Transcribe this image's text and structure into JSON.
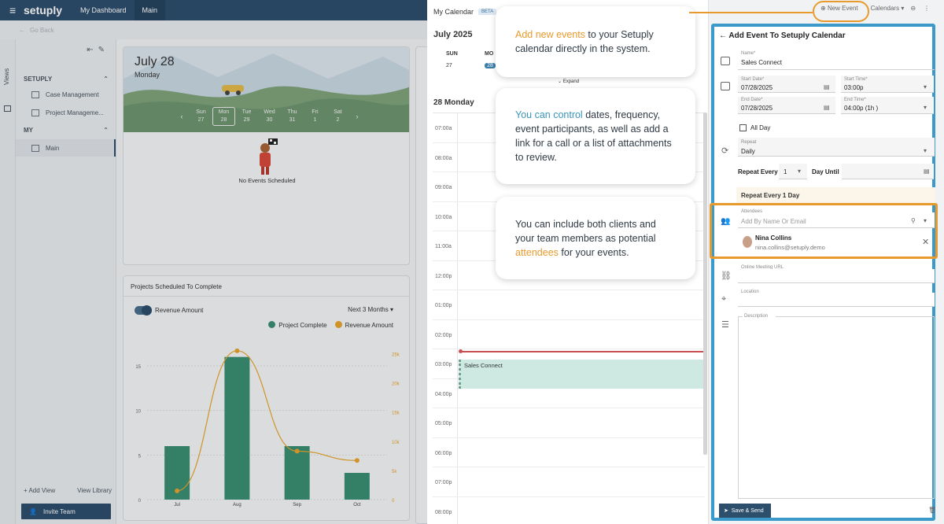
{
  "topbar": {
    "brand": "setuply",
    "tabs": [
      "My Dashboard",
      "Main"
    ]
  },
  "subbar": {
    "back_label": "Go Back"
  },
  "rail": {
    "label": "Views"
  },
  "sidebar": {
    "sections": [
      {
        "title": "SETUPLY",
        "items": [
          "Case Management",
          "Project Manageme..."
        ]
      },
      {
        "title": "MY",
        "items": [
          "Main"
        ]
      }
    ],
    "add_view": "Add View",
    "view_library": "View Library",
    "invite_team": "Invite Team"
  },
  "daycard": {
    "date": "July 28",
    "weekday": "Monday",
    "week": [
      {
        "d": "Sun",
        "n": "27"
      },
      {
        "d": "Mon",
        "n": "28"
      },
      {
        "d": "Tue",
        "n": "29"
      },
      {
        "d": "Wed",
        "n": "30"
      },
      {
        "d": "Thu",
        "n": "31"
      },
      {
        "d": "Fri",
        "n": "1"
      },
      {
        "d": "Sat",
        "n": "2"
      }
    ],
    "selected_index": 1,
    "empty_text": "No Events Scheduled"
  },
  "chartcard": {
    "title": "Projects Scheduled To Complete",
    "toggle_label": "Revenue Amount",
    "range_label": "Next 3 Months",
    "legend": [
      {
        "label": "Project Complete",
        "color": "#3a8f73"
      },
      {
        "label": "Revenue Amount",
        "color": "#e8a42c"
      }
    ]
  },
  "chart_data": {
    "type": "bar",
    "categories": [
      "Jul",
      "Aug",
      "Sep",
      "Oct"
    ],
    "series": [
      {
        "name": "Project Complete",
        "values": [
          6,
          16,
          6,
          3
        ],
        "axis": "left"
      },
      {
        "name": "Revenue Amount",
        "values": [
          1500,
          25500,
          8300,
          6700
        ],
        "axis": "right"
      }
    ],
    "yticks_left": [
      0,
      5,
      10,
      15
    ],
    "ylim_left": [
      0,
      18
    ],
    "yticks_right": [
      "0",
      "5k",
      "10k",
      "15k",
      "20k",
      "25k"
    ],
    "ylim_right": [
      0,
      27500
    ]
  },
  "calendar": {
    "title": "My Calendar",
    "badge": "BETA",
    "month": "July 2025",
    "dow": [
      "SUN",
      "MO"
    ],
    "dom": [
      "27",
      "28"
    ],
    "expand": "Expand",
    "day_label": "28 Monday",
    "hours": [
      "07:00a",
      "08:00a",
      "09:00a",
      "10:00a",
      "11:00a",
      "12:00p",
      "01:00p",
      "02:00p",
      "03:00p",
      "04:00p",
      "05:00p",
      "06:00p",
      "07:00p",
      "08:00p"
    ],
    "event": "Sales Connect"
  },
  "tips": [
    {
      "pre": "",
      "hl": "Add new events",
      "post": " to your Setuply calendar directly in the system.",
      "hl_color": "orange"
    },
    {
      "pre": "",
      "hl": "You can control",
      "post": " dates, frequency, event participants, as well as add a link for a call or a list of attachments to review.",
      "hl_color": "blue"
    },
    {
      "pre": "You can include both clients and your team members as potential ",
      "hl": "attendees",
      "post": " for your events.",
      "hl_color": "orange"
    }
  ],
  "topright": {
    "new_event": "New Event",
    "calendars": "Calendars"
  },
  "form": {
    "title": "Add Event To Setuply Calendar",
    "name_label": "Name*",
    "name_value": "Sales Connect",
    "start_date_label": "Start Date*",
    "start_date": "07/28/2025",
    "start_time_label": "Start Time*",
    "start_time": "03:00p",
    "end_date_label": "End Date*",
    "end_date": "07/28/2025",
    "end_time_label": "End Time*",
    "end_time": "04:00p (1h )",
    "all_day": "All Day",
    "repeat_label": "Repeat",
    "repeat_value": "Daily",
    "repeat_every_label": "Repeat Every",
    "repeat_every_value": "1",
    "day_until_label": "Day Until",
    "repeat_summary": "Repeat Every 1 Day",
    "attendees_label": "Attendees",
    "attendees_placeholder": "Add By Name Or Email",
    "attendee_name": "Nina Collins",
    "attendee_email": "nina.collins@setuply.demo",
    "meeting_url_label": "Online Meeting URL",
    "location_label": "Location",
    "description_label": "Description",
    "save_label": "Save & Send"
  }
}
